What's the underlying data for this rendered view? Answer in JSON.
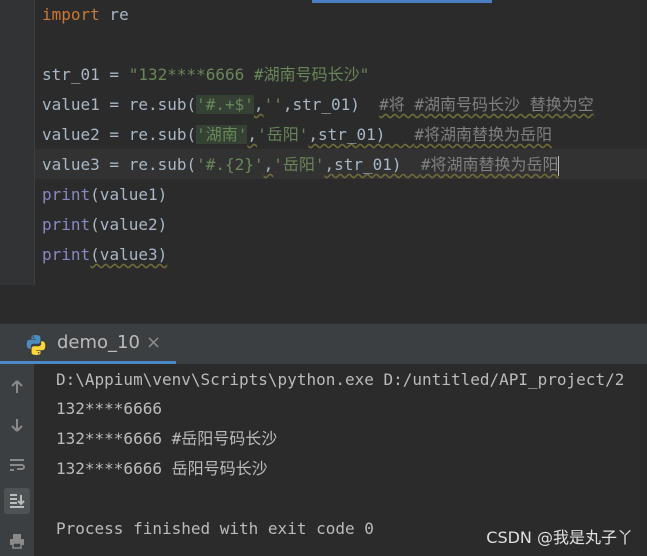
{
  "editor": {
    "lines": {
      "l1": {
        "kw": "import",
        "rest": " re"
      },
      "l3": {
        "prefix": "str_01 = ",
        "str": "\"132****6666 #湖南号码长沙\""
      },
      "l4": {
        "prefix": "value1 = re.sub(",
        "s1": "'#.+$'",
        "sep1": ",",
        "s2": "''",
        "sep2": ",str_01)  ",
        "comment": "#将 #湖南号码长沙 替换为空"
      },
      "l5": {
        "prefix": "value2 = re.sub(",
        "s1q1": "'",
        "s1": "湖南",
        "s1q2": "'",
        "sep1": ",",
        "s2": "'岳阳'",
        "sep2": ",str_01)   ",
        "comment": "#将湖南替换为岳阳"
      },
      "l6": {
        "prefix": "value3 = re.sub(",
        "s1": "'#.{2}'",
        "sep1": ",",
        "s2": "'岳阳'",
        "sep2": ",str_01)  ",
        "comment": "#将湖南替换为岳阳"
      },
      "l7": {
        "fn": "print",
        "args": "(value1)"
      },
      "l8": {
        "fn": "print",
        "args": "(value2)"
      },
      "l9": {
        "fn": "print",
        "args": "(value3)"
      }
    }
  },
  "run_panel": {
    "tab_label": "demo_10",
    "tab_close": "×",
    "output_lines": [
      "D:\\Appium\\venv\\Scripts\\python.exe D:/untitled/API_project/2",
      "132****6666",
      "132****6666 #岳阳号码长沙",
      "132****6666 岳阳号码长沙",
      "",
      "Process finished with exit code 0"
    ],
    "tools": [
      "arrow-up-icon",
      "arrow-down-icon",
      "soft-wrap-icon",
      "scroll-to-end-icon",
      "print-icon"
    ]
  },
  "watermark": "CSDN @我是丸子丫",
  "colors": {
    "keyword": "#cc7832",
    "string": "#6a8759",
    "comment": "#808080",
    "builtin": "#8888c6",
    "text": "#a9b7c6",
    "background": "#2b2b2b"
  }
}
